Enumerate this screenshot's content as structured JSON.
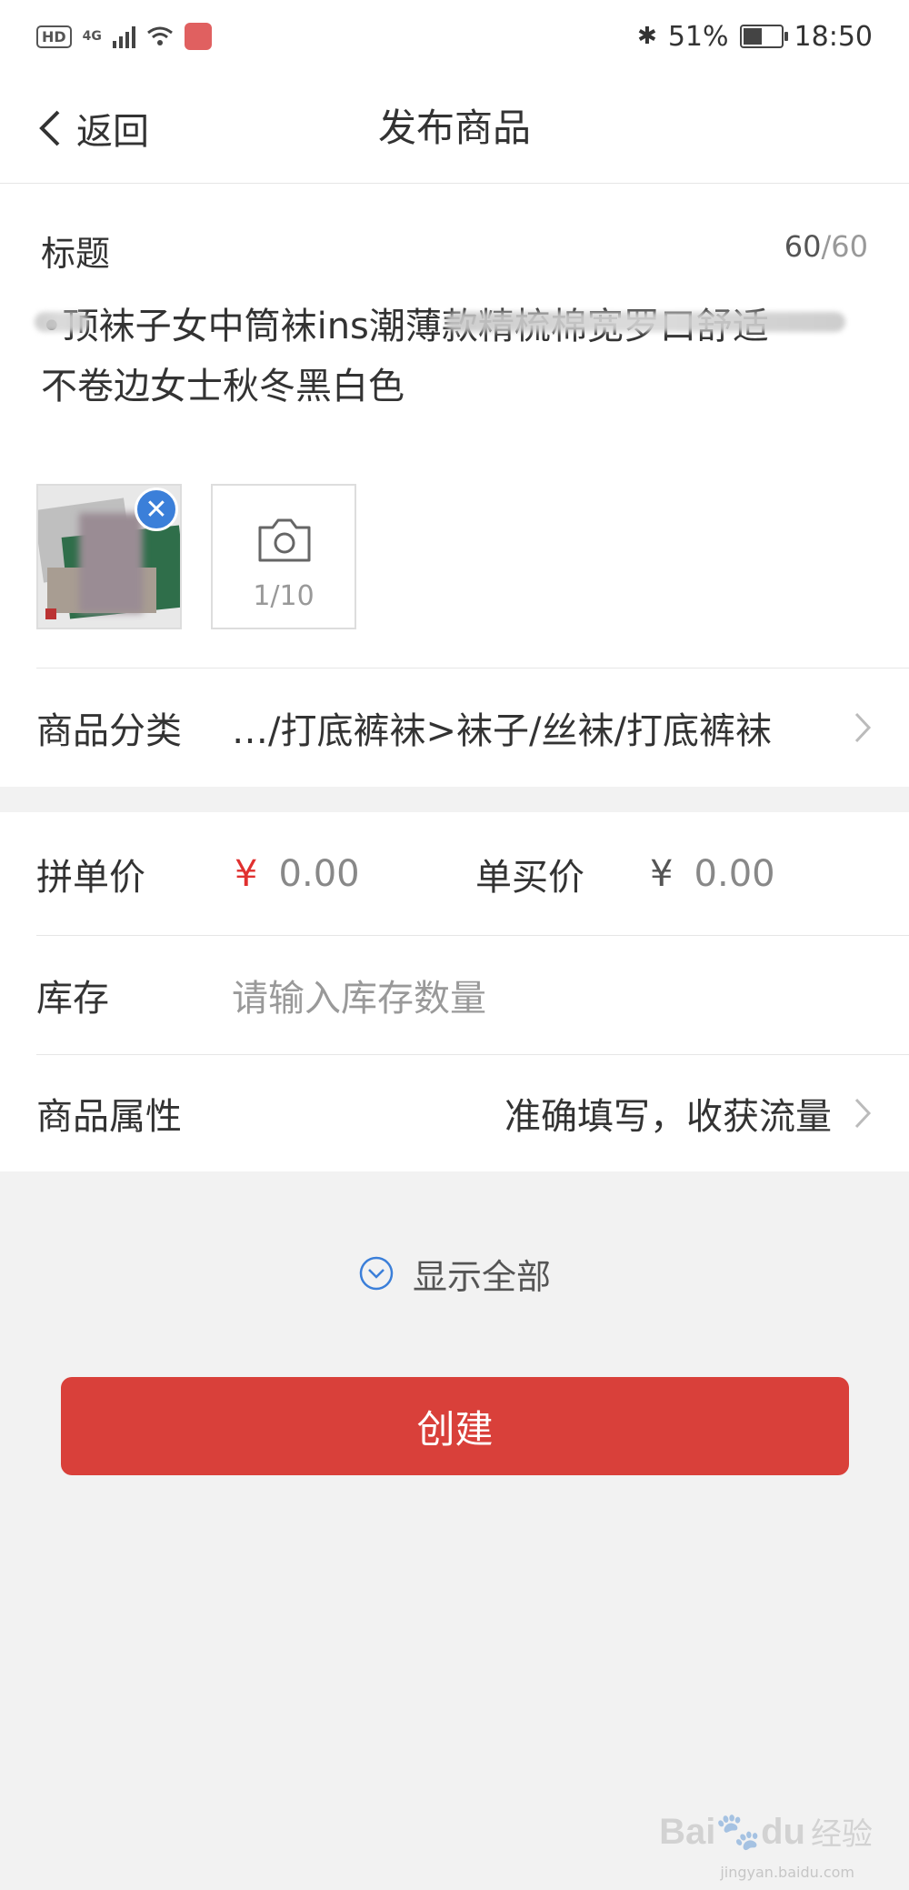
{
  "status_bar": {
    "hd": "HD",
    "network": "4G",
    "battery_percent": "51%",
    "battery_level": 0.51,
    "time": "18:50",
    "icons": [
      "bluetooth-icon",
      "battery-icon",
      "wifi-icon",
      "signal-icon"
    ]
  },
  "nav": {
    "back_label": "返回",
    "title": "发布商品"
  },
  "title_section": {
    "label": "标题",
    "count_current": "60",
    "count_max": "/60",
    "text_line1": "•顶袜子女中筒袜ins潮薄款精梳棉宽罗口舒适",
    "text_line2": "不卷边女士秋冬黑白色"
  },
  "photos": {
    "add_count": "1/10"
  },
  "category": {
    "label": "商品分类",
    "value": "…/打底裤袜>袜子/丝袜/打底裤袜"
  },
  "price": {
    "group_label": "拼单价",
    "group_symbol": "¥",
    "group_value": "0.00",
    "single_label": "单买价",
    "single_symbol": "¥",
    "single_value": "0.00"
  },
  "stock": {
    "label": "库存",
    "placeholder": "请输入库存数量"
  },
  "attributes": {
    "label": "商品属性",
    "hint": "准确填写，收获流量"
  },
  "show_all": {
    "label": "显示全部"
  },
  "create_button": {
    "label": "创建"
  },
  "watermark": {
    "logo": "Bai",
    "logo2": "du",
    "text": "经验",
    "sub": "jingyan.baidu.com"
  },
  "colors": {
    "accent_red": "#d9403a",
    "price_red": "#e0302f",
    "remove_blue": "#3b7fd9"
  }
}
